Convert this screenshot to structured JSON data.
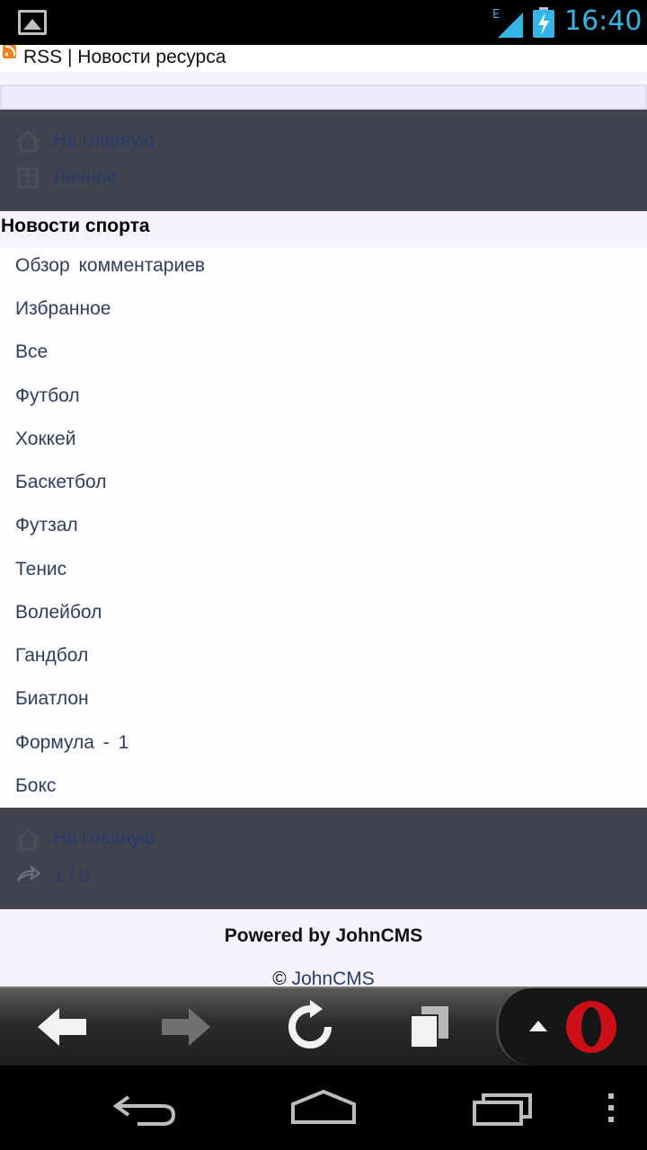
{
  "status_bar": {
    "time": "16:40",
    "network_type": "E",
    "icons": [
      "gallery-notification-icon",
      "signal-icon",
      "battery-charging-icon"
    ]
  },
  "rss_bar": {
    "title": "RSS | Новости ресурса"
  },
  "top_menu": {
    "items": [
      {
        "label": "На главную",
        "icon": "home-icon"
      },
      {
        "label": "Личное",
        "icon": "personal-icon"
      }
    ]
  },
  "section": {
    "title": "Новости спорта"
  },
  "news_list": {
    "items": [
      "Обзор комментариев",
      "Избранное",
      "Все",
      "Футбол",
      "Хоккей",
      "Баскетбол",
      "Футзал",
      "Тенис",
      "Волейбол",
      "Гандбол",
      "Биатлон",
      "Формула - 1",
      "Бокс"
    ]
  },
  "bottom_menu": {
    "items": [
      {
        "label": "На главную",
        "icon": "home-icon"
      },
      {
        "label": "1 / 0",
        "icon": "online-counter-icon"
      }
    ]
  },
  "footer": {
    "powered": "Powered by JohnCMS",
    "copyright_symbol": "©",
    "copyright_link": "JohnCMS"
  },
  "browser_toolbar": {
    "buttons": [
      "back-icon",
      "forward-icon",
      "reload-icon",
      "tabs-icon",
      "menu-up-icon",
      "opera-logo-icon"
    ]
  },
  "system_nav": {
    "buttons": [
      "back-nav-icon",
      "home-nav-icon",
      "recents-nav-icon",
      "overflow-menu-icon"
    ]
  },
  "colors": {
    "menu_block_bg": "#41434f",
    "link_color": "#283b6e",
    "status_accent": "#33b5e5",
    "opera_red": "#cc0f16"
  }
}
